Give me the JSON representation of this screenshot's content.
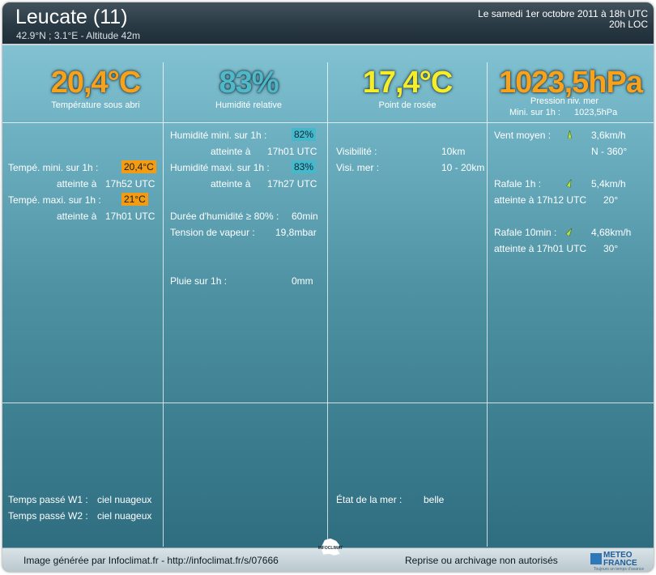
{
  "header": {
    "title": "Leucate (11)",
    "coords": "42.9°N ; 3.1°E - Altitude 42m",
    "date": "Le samedi 1er octobre 2011 à 18h UTC",
    "local_time": "20h LOC"
  },
  "col1": {
    "big": "20,4°C",
    "label": "Température sous abri",
    "min_label": "Tempé. mini. sur 1h :",
    "min_value": "20,4°C",
    "min_reached_label": "atteinte à",
    "min_time": "17h52 UTC",
    "max_label": "Tempé. maxi. sur 1h :",
    "max_value": "21°C",
    "max_reached_label": "atteinte à",
    "max_time": "17h01 UTC",
    "w1_label": "Temps passé W1 :",
    "w1_value": "ciel nuageux",
    "w2_label": "Temps passé W2 :",
    "w2_value": "ciel nuageux"
  },
  "col2": {
    "big": "83%",
    "label": "Humidité relative",
    "min_label": "Humidité mini. sur 1h :",
    "min_value": "82%",
    "min_reached_label": "atteinte à",
    "min_time": "17h01 UTC",
    "max_label": "Humidité maxi. sur 1h :",
    "max_value": "83%",
    "max_reached_label": "atteinte à",
    "max_time": "17h27 UTC",
    "duration_label": "Durée d'humidité ≥ 80% :",
    "duration_value": "60min",
    "vapor_label": "Tension de vapeur :",
    "vapor_value": "19,8mbar",
    "rain_label": "Pluie sur 1h :",
    "rain_value": "0mm"
  },
  "col3": {
    "big": "17,4°C",
    "label": "Point de rosée",
    "vis_label": "Visibilité :",
    "vis_value": "10km",
    "vis_sea_label": "Visi. mer :",
    "vis_sea_value": "10 - 20km",
    "sea_label": "État de la mer :",
    "sea_value": "belle"
  },
  "col4": {
    "big": "1023,5hPa",
    "label": "Pression niv. mer",
    "min_label": "Mini. sur 1h :",
    "min_value": "1023,5hPa",
    "wind_label": "Vent moyen :",
    "wind_speed": "3,6km/h",
    "wind_dir": "N - 360°",
    "gust1_label": "Rafale 1h :",
    "gust1_speed": "5,4km/h",
    "gust1_time": "atteinte à 17h12 UTC",
    "gust1_dir": "20°",
    "gust10_label": "Rafale 10min :",
    "gust10_speed": "4,68km/h",
    "gust10_time": "atteinte à 17h01 UTC",
    "gust10_dir": "30°"
  },
  "footer": {
    "generated": "Image générée par Infoclimat.fr - http://infoclimat.fr/s/07666",
    "rights": "Reprise ou archivage non autorisés",
    "logo_line1": "METEO",
    "logo_line2": "FRANCE",
    "logo_tagline": "Toujours un temps d'avance",
    "infoclimat_logo": "INFOCLIMAT"
  },
  "colors": {
    "orange": "#f7a21a",
    "teal": "#4fb9c9",
    "yellow": "#f5ec2a",
    "badge_orange": "#f39c12",
    "badge_teal": "#46b8cc"
  },
  "icons": [
    "wind-direction-icon",
    "gust-direction-icon",
    "france-map-icon",
    "meteo-france-logo-icon"
  ]
}
